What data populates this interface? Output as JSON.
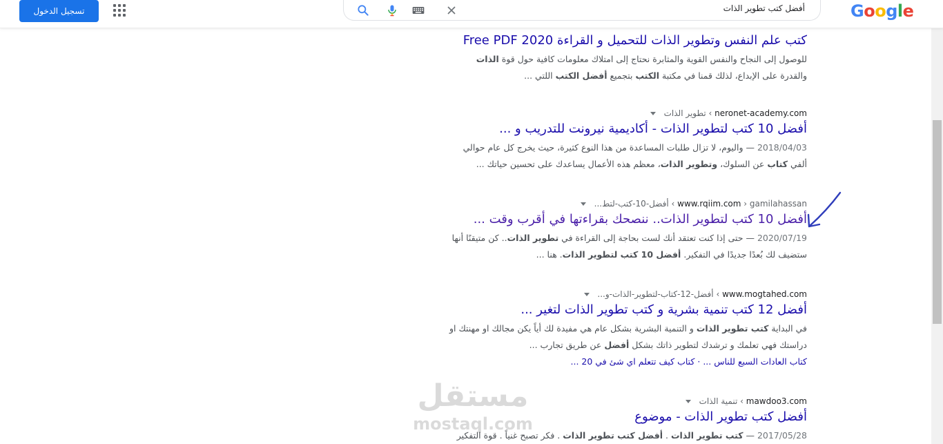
{
  "header": {
    "signin_label": "تسجيل الدخول",
    "search_query": "أفضل كتب تطوير الذات",
    "logo_letters": [
      "G",
      "o",
      "o",
      "g",
      "l",
      "e"
    ]
  },
  "results": [
    {
      "url_domain": "",
      "url_path": "",
      "title": "كتب علم النفس وتطوير الذات للتحميل و القراءة 2020 Free PDF",
      "snippet_html": "للوصول إلى النجاح والنفس القوية والمثابرة نحتاج إلى امتلاك معلومات كافية حول قوة <b>الذات</b><br>والقدرة على الإبداع، لذلك قمنا في مكتبة <b>الكتب</b> بتجميع <b>أفضل الكتب</b> اللتي ..."
    },
    {
      "url_domain": "neronet-academy.com",
      "url_path": "› تطوير الذات",
      "title": "أفضل 10 كتب لتطوير الذات - أكاديمية نيرونت للتدريب و ...",
      "date": "2018/04/03",
      "snippet_html": " — واليوم، لا تزال طلبات المساعدة من هذا النوع كثيرة، حيث يخرج كل عام حوالي<br>ألفي <b>كتاب</b> عن السلوك، <b>وتطوير الذات</b>، معظم هذه الأعمال يساعدك على تحسين حياتك ..."
    },
    {
      "url_domain": "www.rqiim.com",
      "url_path": "› gamilahassan › أفضل-10-كتب-لتط...",
      "title": "أفضل 10 كتب لتطوير الذات.. ننصحك بقراءتها في أقرب وقت ...",
      "date": "2020/07/19",
      "snippet_html": " — حتى إذا كنت تعتقد أنك لست بحاجة إلى القراءة في <b>تطوير الذات</b>.. كن متيقنًا أنها<br>ستضيف لك بُعدًا جديدًا في التفكير. <b>أفضل 10 كتب لتطوير الذات</b>. هنا ..."
    },
    {
      "url_domain": "www.mogtahed.com",
      "url_path": "› أفضل-12-كتاب-لتطوير-الذات-و...",
      "title": "أفضل 12 كتب تنمية بشرية و كتب تطوير الذات لتغير ...",
      "snippet_html": "في البداية <b>كتب تطوير الذات</b> و التنمية البشرية بشكل عام هي مفيدة لك أياً يكن مجالك او مهنتك او<br>دراستك فهي تعلمك و ترشدك لتطوير ذاتك بشكل <b>أفضل</b> عن طريق تجارب ...",
      "sitelinks": "كتاب العادات السبع للناس ... · كتاب كيف تتعلم اي شئ في 20 ..."
    },
    {
      "url_domain": "mawdoo3.com",
      "url_path": "› تنمية الذات",
      "title": "أفضل كتب تطوير الذات - موضوع",
      "date": "2017/05/28",
      "snippet_html": " — <b>كتب تطوير الذات</b> . <b>أفضل كتب تطوير الذات</b> . فكر تصبح غنياً . قوة التفكير"
    }
  ],
  "watermark": {
    "arabic": "مستقل",
    "latin": "mostaql.com"
  }
}
